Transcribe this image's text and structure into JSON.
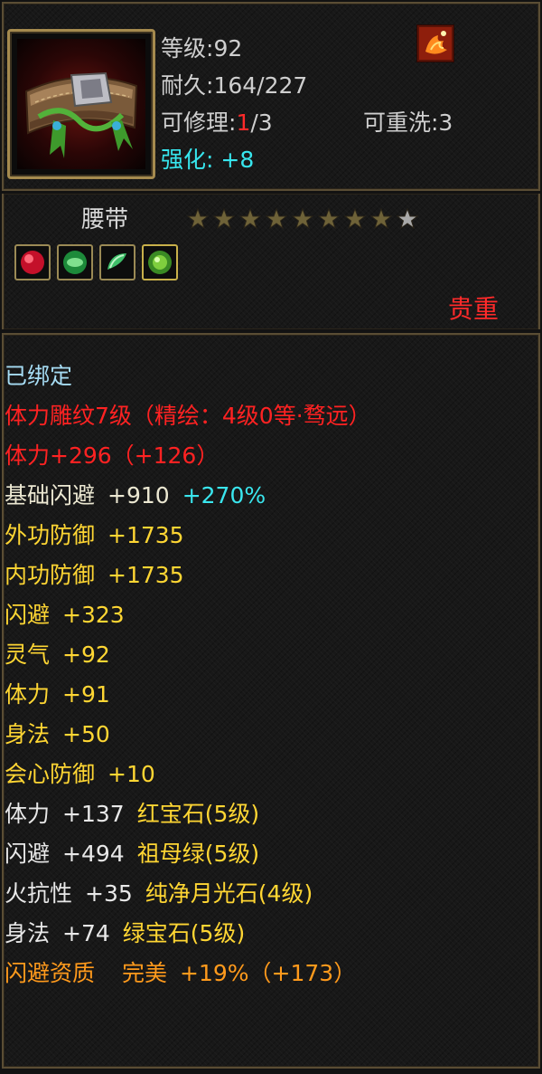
{
  "item": {
    "level_label": "等级",
    "level_value": ":92",
    "durability_label": "耐久",
    "durability_value": ":164/227",
    "repair_label": "可修理:",
    "repair_used": "1",
    "repair_max": "/3",
    "rewash_label": "可重洗:3",
    "enhance_label": "强化:",
    "enhance_value": "+8",
    "type": "腰带",
    "stars_filled": 8,
    "stars_total": 9,
    "rarity": "贵重",
    "icon": "belt-icon",
    "badge_icon": "bird-emblem-icon",
    "gem_icons": [
      "ruby-gem-icon",
      "emerald-gem-icon",
      "moonstone-gem-icon",
      "green-gem-icon"
    ]
  },
  "attributes": [
    {
      "parts": [
        {
          "text": "已绑定",
          "color": "bound"
        }
      ]
    },
    {
      "parts": [
        {
          "text": "体力雕纹7级（精绘：4级0等·骛远）",
          "color": "red"
        }
      ]
    },
    {
      "parts": [
        {
          "text": "体力+296（+126）",
          "color": "red"
        }
      ]
    },
    {
      "parts": [
        {
          "text": "基础闪避",
          "color": "beige"
        },
        {
          "text": "+910",
          "color": "beige"
        },
        {
          "text": "+270%",
          "color": "cyan"
        }
      ]
    },
    {
      "parts": [
        {
          "text": "外功防御",
          "color": "yellow"
        },
        {
          "text": "+1735",
          "color": "yellow"
        }
      ]
    },
    {
      "parts": [
        {
          "text": "内功防御",
          "color": "yellow"
        },
        {
          "text": "+1735",
          "color": "yellow"
        }
      ]
    },
    {
      "parts": [
        {
          "text": "闪避",
          "color": "yellow"
        },
        {
          "text": "+323",
          "color": "yellow"
        }
      ]
    },
    {
      "parts": [
        {
          "text": "灵气",
          "color": "yellow"
        },
        {
          "text": "+92",
          "color": "yellow"
        }
      ]
    },
    {
      "parts": [
        {
          "text": "体力",
          "color": "yellow"
        },
        {
          "text": "+91",
          "color": "yellow"
        }
      ]
    },
    {
      "parts": [
        {
          "text": "身法",
          "color": "yellow"
        },
        {
          "text": "+50",
          "color": "yellow"
        }
      ]
    },
    {
      "parts": [
        {
          "text": "会心防御",
          "color": "yellow"
        },
        {
          "text": "+10",
          "color": "yellow"
        }
      ]
    },
    {
      "parts": [
        {
          "text": "体力",
          "color": "white"
        },
        {
          "text": "+137",
          "color": "white"
        },
        {
          "text": "红宝石(5级)",
          "color": "yellow"
        }
      ]
    },
    {
      "parts": [
        {
          "text": "闪避",
          "color": "white"
        },
        {
          "text": "+494",
          "color": "white"
        },
        {
          "text": "祖母绿(5级)",
          "color": "yellow"
        }
      ]
    },
    {
      "parts": [
        {
          "text": "火抗性",
          "color": "white"
        },
        {
          "text": "+35",
          "color": "white"
        },
        {
          "text": "纯净月光石(4级)",
          "color": "yellow"
        }
      ]
    },
    {
      "parts": [
        {
          "text": "身法",
          "color": "white"
        },
        {
          "text": "+74",
          "color": "white"
        },
        {
          "text": "绿宝石(5级)",
          "color": "yellow"
        }
      ]
    },
    {
      "parts": [
        {
          "text": "闪避资质",
          "color": "orange"
        },
        {
          "text": "完美",
          "color": "orange",
          "wide": true
        },
        {
          "text": "+19%（+173）",
          "color": "orange"
        }
      ]
    }
  ],
  "colors": {
    "bound": "#a6dcf4",
    "red": "#ff2222",
    "beige": "#ece8d2",
    "yellow": "#ffd633",
    "cyan": "#3ae6ee",
    "white": "#e8e8e8",
    "orange": "#ff9a1c",
    "frame_gold": "#a58a4e"
  }
}
